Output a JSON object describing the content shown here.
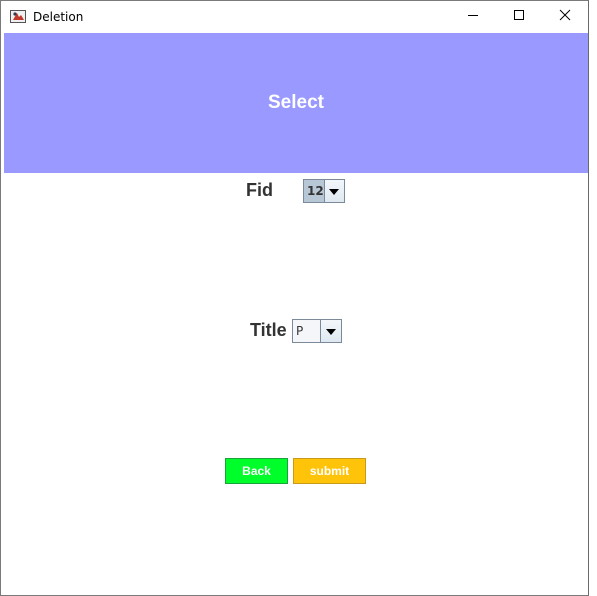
{
  "window": {
    "title": "Deletion",
    "controls": {
      "minimize_icon": "minimize-icon",
      "maximize_icon": "maximize-icon",
      "close_icon": "close-icon"
    }
  },
  "header": {
    "title": "Select",
    "background": "#9999ff"
  },
  "form": {
    "fid_label": "Fid",
    "fid_value": "12",
    "title_label": "Title",
    "title_value": "P"
  },
  "buttons": {
    "back_label": "Back",
    "back_color": "#00ff2a",
    "submit_label": "submit",
    "submit_color": "#ffc40a"
  }
}
